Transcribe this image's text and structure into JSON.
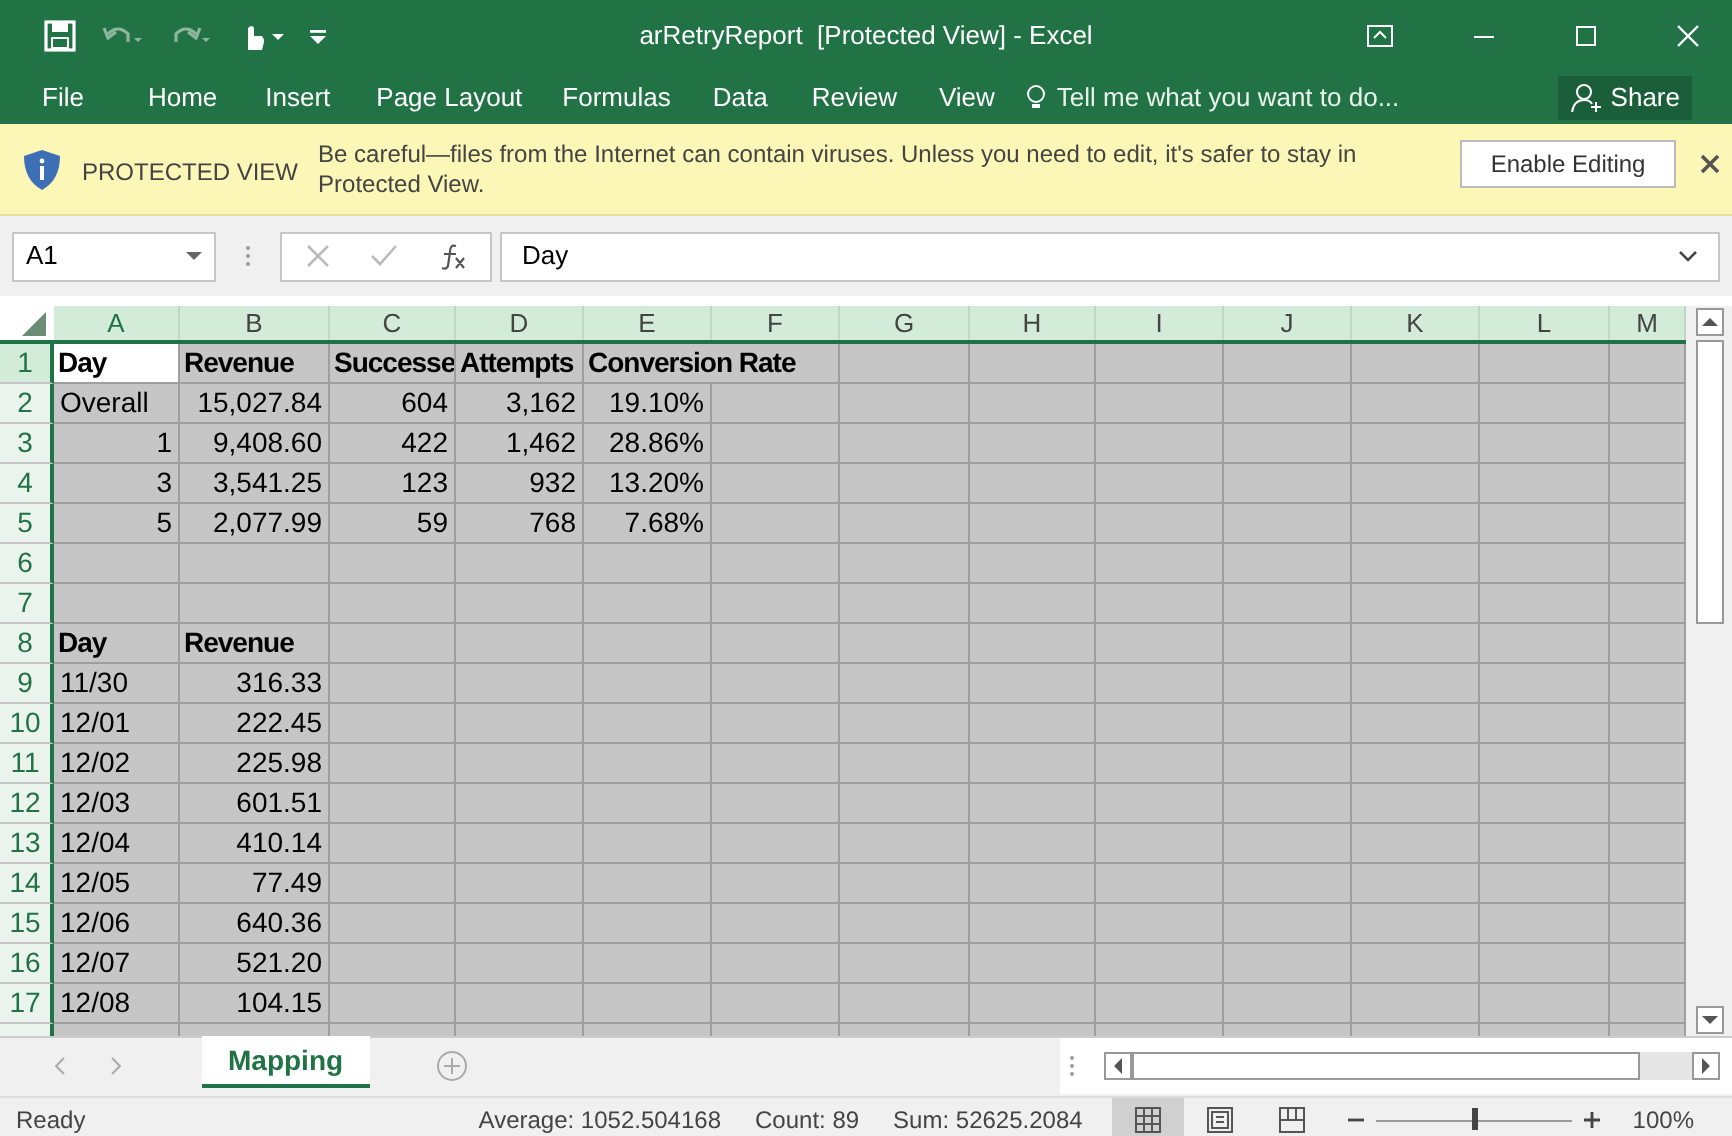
{
  "window": {
    "title": "arRetryReport  [Protected View] - Excel"
  },
  "ribbon_tabs": [
    "File",
    "Home",
    "Insert",
    "Page Layout",
    "Formulas",
    "Data",
    "Review",
    "View"
  ],
  "tell_me": {
    "placeholder": "Tell me what you want to do..."
  },
  "share_button": "Share",
  "protected_view": {
    "title": "PROTECTED VIEW",
    "message": "Be careful—files from the Internet can contain viruses. Unless you need to edit, it's safer to stay in Protected View.",
    "button": "Enable Editing"
  },
  "name_box": {
    "value": "A1"
  },
  "formula_bar": {
    "value": "Day"
  },
  "grid": {
    "columns": [
      "A",
      "B",
      "C",
      "D",
      "E",
      "F",
      "G",
      "H",
      "I",
      "J",
      "K",
      "L",
      "M"
    ],
    "rows": [
      {
        "number": "1",
        "kind": "heading",
        "cells": [
          {
            "text": "Day",
            "kind": "text",
            "selected": true
          },
          {
            "text": "Revenue",
            "kind": "text",
            "selected": false
          },
          {
            "text": "Successe",
            "kind": "text",
            "selected": false
          },
          {
            "text": "Attempts",
            "kind": "text",
            "selected": false
          },
          {
            "text": "Conversion Rate",
            "kind": "text",
            "selected": false
          }
        ]
      },
      {
        "number": "2",
        "kind": "data",
        "cells": [
          {
            "text": "Overall",
            "kind": "text",
            "selected": false
          },
          {
            "text": "15,027.84",
            "kind": "number",
            "selected": false
          },
          {
            "text": "604",
            "kind": "number",
            "selected": false
          },
          {
            "text": "3,162",
            "kind": "number",
            "selected": false
          },
          {
            "text": "19.10%",
            "kind": "number",
            "selected": false
          }
        ]
      },
      {
        "number": "3",
        "kind": "data",
        "cells": [
          {
            "text": "1",
            "kind": "number",
            "selected": false
          },
          {
            "text": "9,408.60",
            "kind": "number",
            "selected": false
          },
          {
            "text": "422",
            "kind": "number",
            "selected": false
          },
          {
            "text": "1,462",
            "kind": "number",
            "selected": false
          },
          {
            "text": "28.86%",
            "kind": "number",
            "selected": false
          }
        ]
      },
      {
        "number": "4",
        "kind": "data",
        "cells": [
          {
            "text": "3",
            "kind": "number",
            "selected": false
          },
          {
            "text": "3,541.25",
            "kind": "number",
            "selected": false
          },
          {
            "text": "123",
            "kind": "number",
            "selected": false
          },
          {
            "text": "932",
            "kind": "number",
            "selected": false
          },
          {
            "text": "13.20%",
            "kind": "number",
            "selected": false
          }
        ]
      },
      {
        "number": "5",
        "kind": "data",
        "cells": [
          {
            "text": "5",
            "kind": "number",
            "selected": false
          },
          {
            "text": "2,077.99",
            "kind": "number",
            "selected": false
          },
          {
            "text": "59",
            "kind": "number",
            "selected": false
          },
          {
            "text": "768",
            "kind": "number",
            "selected": false
          },
          {
            "text": "7.68%",
            "kind": "number",
            "selected": false
          }
        ]
      },
      {
        "number": "6"
      },
      {
        "number": "7"
      },
      {
        "number": "8",
        "kind": "heading",
        "cells": [
          {
            "text": "Day",
            "kind": "text",
            "selected": false
          },
          {
            "text": "Revenue",
            "kind": "text",
            "selected": false
          }
        ]
      },
      {
        "number": "9",
        "kind": "data",
        "cells": [
          {
            "text": "11/30",
            "kind": "text",
            "selected": false
          },
          {
            "text": "316.33",
            "kind": "number",
            "selected": false
          }
        ]
      },
      {
        "number": "10",
        "kind": "data",
        "cells": [
          {
            "text": "12/01",
            "kind": "text",
            "selected": false
          },
          {
            "text": "222.45",
            "kind": "number",
            "selected": false
          }
        ]
      },
      {
        "number": "11",
        "kind": "data",
        "cells": [
          {
            "text": "12/02",
            "kind": "text",
            "selected": false
          },
          {
            "text": "225.98",
            "kind": "number",
            "selected": false
          }
        ]
      },
      {
        "number": "12",
        "kind": "data",
        "cells": [
          {
            "text": "12/03",
            "kind": "text",
            "selected": false
          },
          {
            "text": "601.51",
            "kind": "number",
            "selected": false
          }
        ]
      },
      {
        "number": "13",
        "kind": "data",
        "cells": [
          {
            "text": "12/04",
            "kind": "text",
            "selected": false
          },
          {
            "text": "410.14",
            "kind": "number",
            "selected": false
          }
        ]
      },
      {
        "number": "14",
        "kind": "data",
        "cells": [
          {
            "text": "12/05",
            "kind": "text",
            "selected": false
          },
          {
            "text": "77.49",
            "kind": "number",
            "selected": false
          }
        ]
      },
      {
        "number": "15",
        "kind": "data",
        "cells": [
          {
            "text": "12/06",
            "kind": "text",
            "selected": false
          },
          {
            "text": "640.36",
            "kind": "number",
            "selected": false
          }
        ]
      },
      {
        "number": "16",
        "kind": "data",
        "cells": [
          {
            "text": "12/07",
            "kind": "text",
            "selected": false
          },
          {
            "text": "521.20",
            "kind": "number",
            "selected": false
          }
        ]
      },
      {
        "number": "17",
        "kind": "data",
        "cells": [
          {
            "text": "12/08",
            "kind": "text",
            "selected": false
          },
          {
            "text": "104.15",
            "kind": "number",
            "selected": false
          }
        ]
      }
    ]
  },
  "sheet_tabs": [
    {
      "label": "Mapping",
      "selected": true
    }
  ],
  "status_bar": {
    "mode": "Ready",
    "stats": [
      "Average: 1052.504168",
      "Count: 89",
      "Sum: 52625.2084"
    ],
    "views": [
      {
        "kind": "normal",
        "selected": true
      },
      {
        "kind": "page-layout",
        "selected": false
      },
      {
        "kind": "page-break",
        "selected": false
      }
    ],
    "zoom": {
      "level": 0.5,
      "reading": "100%"
    }
  }
}
